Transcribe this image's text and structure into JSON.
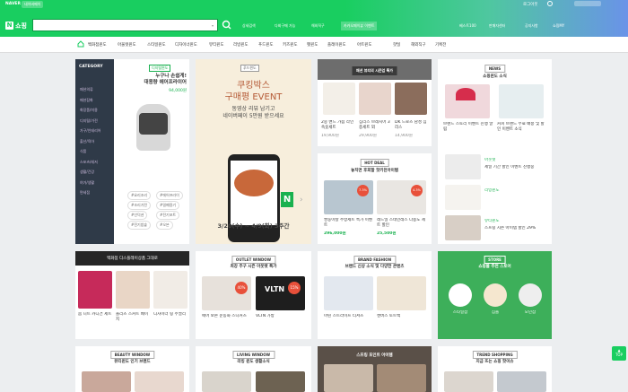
{
  "header": {
    "naver": "NAVER",
    "shortcut": "네이버페이",
    "username": "로그아웃",
    "logo_letter": "N",
    "logo_text": "쇼핑",
    "search_placeholder": "",
    "tools": [
      "상세검색",
      "다회구매 가능",
      "해외직구",
      "카카오페이뷰 이벤트"
    ],
    "best": "베스트100",
    "seller": "판매자센터",
    "notice": "공지사항",
    "myshop": "쇼핑MY"
  },
  "cats": [
    "패션의류",
    "패션잡화",
    "화장품/미용",
    "디지털/가전",
    "가구/인테리어",
    "출산/육아",
    "식품",
    "스포츠/레저",
    "생활/건강",
    "여가/생활편의",
    "면세점"
  ],
  "nav": [
    "백화점윈도",
    "아울렛윈도",
    "스타일윈도",
    "디자이너윈도",
    "뷰티윈도",
    "리빙윈도",
    "푸드윈도",
    "키즈윈도",
    "펫윈도",
    "플레이윈도",
    "아트윈도",
    "핫딜",
    "해외직구",
    "기획전"
  ],
  "sidebar": {
    "head": "CATEGORY",
    "items": [
      "패션의류",
      "패션잡화",
      "화장품/미용",
      "디지털/가전",
      "가구/인테리어",
      "출산/육아",
      "식품",
      "스포츠/레저",
      "생활/건강",
      "여가/생활",
      "면세점"
    ]
  },
  "card1": {
    "badge": "디지털윈도",
    "title1": "누구나 손쉽게!",
    "title2": "대용량 에어프라이어",
    "price": "94,000원",
    "tags": [
      "#요리조리",
      "#에어프라이",
      "#조리가전",
      "#밀폐용기",
      "#냄비",
      "#주방소형가전",
      "#수입가전",
      "#소형가전",
      "#인덕션",
      "#전기포트",
      "#주방용품",
      "#그릴",
      "#전기밥솥",
      "#오븐",
      "#식기건조",
      "#인쇄밥"
    ]
  },
  "card2": {
    "badge": "푸드윈도",
    "title1": "쿠킹박스",
    "title2": "구매평 EVENT",
    "sub1": "동영상 리뷰 남기고",
    "sub2": "네이버페이 5만원 받으세요",
    "date": "3/20(수) ~ 4/9(화) 3주간",
    "arrow_l": "‹",
    "arrow_r": "›"
  },
  "card3": {
    "head": "패션 뷰티의 시즌업 특가",
    "items": [
      {
        "name": "2중 밴드 가슴 라인 속옷세트",
        "price": "19,900원"
      },
      {
        "name": "심리스 브래지어 3종세트 외",
        "price": "29,900원"
      },
      {
        "name": "DK 드로즈 남성 심리스",
        "price": "14,900원"
      }
    ]
  },
  "card4": {
    "head": "HOT DEAL",
    "title": "놓치면 후회할 핫키친아이템",
    "items": [
      {
        "name": "쌍둥이칼 주방세트 특가 이벤트",
        "price": "296,000원",
        "badge": "7.3%"
      },
      {
        "name": "레드밀 스테인레스 다용도 세트 할인",
        "price": "25,500원",
        "badge": "4.3%"
      }
    ]
  },
  "card5": {
    "head": "NEWS",
    "title": "쇼핑윈도 소식",
    "items": [
      "브랜드 스토리 이벤트 진행 알림",
      "커피 브랜드 무료 배송 및 할인 이벤트 소식",
      "세일 기간 할인 이벤트 진행중",
      "스프링 시즌 아이템 할인 29%"
    ],
    "labels": [
      "패션윈도",
      "리빙윈도",
      "아웃렛",
      "뷰티윈도"
    ]
  },
  "row2": {
    "c1head": "백화점 디스플레이상품 그대로",
    "c1items": [
      "봄 니트 카디건 세트",
      "플리츠 스커트 베이지",
      "디자이너 링 주얼리"
    ],
    "c2head": "OUTLET WINDOW",
    "c2title": "최강 주구 시즌 아웃렛 특가",
    "c2items": [
      "에어 보온 운동화 스니커즈",
      "VLTN 가방"
    ],
    "c3head": "BRAND FASHION",
    "c3title": "브랜드 신상 소식 및 다양한 콘텐츠",
    "c3items": [
      "마린 스트라이프 티셔츠",
      "캔버스 토트백"
    ],
    "c4head": "STORE",
    "c4title": "쇼핑몰 추천 스토어",
    "c4items": [
      "스타일샵",
      "심플",
      "모던샵"
    ]
  },
  "row3": {
    "c1head": "BEAUTY WINDOW",
    "c1title": "뷰티윈도 인기 브랜드",
    "c2head": "LIVING WINDOW",
    "c2title": "리빙 윈도 생활소식",
    "c3head": "스프링 포인트 아이템",
    "c4head": "TREND SHOPPING",
    "c4title": "지금 뜨는 쇼핑 핫이슈"
  },
  "top_btn": "TOP"
}
